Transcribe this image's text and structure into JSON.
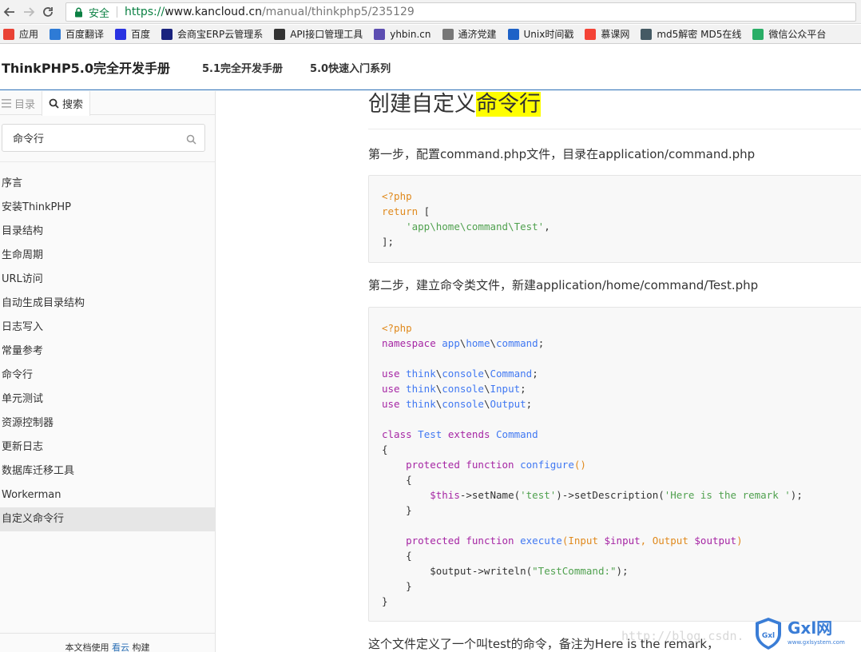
{
  "browser": {
    "secure_label": "安全",
    "url_protocol": "https://",
    "url_host": "www.kancloud.cn",
    "url_path": "/manual/thinkphp5/235129"
  },
  "bookmarks": [
    {
      "label": "应用",
      "icon": "apps-grid-icon",
      "color": "#e94235"
    },
    {
      "label": "百度翻译",
      "icon": "baidu-fanyi-icon",
      "color": "#2e7bd6"
    },
    {
      "label": "百度",
      "icon": "baidu-paw-icon",
      "color": "#2932e1"
    },
    {
      "label": "会商宝ERP云管理系",
      "icon": "bird-icon",
      "color": "#1a237e"
    },
    {
      "label": "API接口管理工具",
      "icon": "shuffle-icon",
      "color": "#333333"
    },
    {
      "label": "yhbin.cn",
      "icon": "shield-icon",
      "color": "#5c4db1"
    },
    {
      "label": "通济党建",
      "icon": "page-icon",
      "color": "#777777"
    },
    {
      "label": "Unix时间戳",
      "icon": "unix-icon",
      "color": "#1e62c7"
    },
    {
      "label": "慕课网",
      "icon": "fire-icon",
      "color": "#f44336"
    },
    {
      "label": "md5解密 MD5在线",
      "icon": "md5-icon",
      "color": "#455a64"
    },
    {
      "label": "微信公众平台",
      "icon": "wechat-icon",
      "color": "#2aae67"
    }
  ],
  "site": {
    "title": "ThinkPHP5.0完全开发手册",
    "nav": [
      "5.1完全开发手册",
      "5.0快速入门系列"
    ]
  },
  "sidebar": {
    "tabs": [
      {
        "label": "目录"
      },
      {
        "label": "搜索"
      }
    ],
    "search_value": "命令行",
    "items": [
      "序言",
      "安装ThinkPHP",
      "目录结构",
      "生命周期",
      "URL访问",
      "自动生成目录结构",
      "日志写入",
      "常量参考",
      "命令行",
      "单元测试",
      "资源控制器",
      "更新日志",
      "数据库迁移工具",
      "Workerman",
      "自定义命令行"
    ],
    "active_index": 14,
    "footer": {
      "prefix": "本文档使用 ",
      "link": "看云",
      "suffix": " 构建"
    }
  },
  "article": {
    "title_plain": "创建自定义",
    "title_highlight": "命令行",
    "step1": "第一步，配置command.php文件，目录在application/command.php",
    "step2": "第二步，建立命令类文件，新建application/home/command/Test.php",
    "step3": "这个文件定义了一个叫test的命令，备注为Here is the remark，"
  },
  "code1": [
    [
      [
        "op",
        "<?php"
      ]
    ],
    [
      [
        "op",
        "return"
      ],
      [
        "pl",
        " ["
      ]
    ],
    [
      [
        "pl",
        "    "
      ],
      [
        "st",
        "'app\\home\\command\\Test'"
      ],
      [
        "pl",
        ","
      ]
    ],
    [
      [
        "pl",
        "];"
      ]
    ]
  ],
  "code2": [
    [
      [
        "op",
        "<?php"
      ]
    ],
    [
      [
        "kw",
        "namespace"
      ],
      [
        "pl",
        " "
      ],
      [
        "ty",
        "app"
      ],
      [
        "pl",
        "\\"
      ],
      [
        "ty",
        "home"
      ],
      [
        "pl",
        "\\"
      ],
      [
        "ty",
        "command"
      ],
      [
        "pl",
        ";"
      ]
    ],
    [],
    [
      [
        "kw",
        "use"
      ],
      [
        "pl",
        " "
      ],
      [
        "ty",
        "think"
      ],
      [
        "pl",
        "\\"
      ],
      [
        "ty",
        "console"
      ],
      [
        "pl",
        "\\"
      ],
      [
        "ty",
        "Command"
      ],
      [
        "pl",
        ";"
      ]
    ],
    [
      [
        "kw",
        "use"
      ],
      [
        "pl",
        " "
      ],
      [
        "ty",
        "think"
      ],
      [
        "pl",
        "\\"
      ],
      [
        "ty",
        "console"
      ],
      [
        "pl",
        "\\"
      ],
      [
        "ty",
        "Input"
      ],
      [
        "pl",
        ";"
      ]
    ],
    [
      [
        "kw",
        "use"
      ],
      [
        "pl",
        " "
      ],
      [
        "ty",
        "think"
      ],
      [
        "pl",
        "\\"
      ],
      [
        "ty",
        "console"
      ],
      [
        "pl",
        "\\"
      ],
      [
        "ty",
        "Output"
      ],
      [
        "pl",
        ";"
      ]
    ],
    [],
    [
      [
        "kw",
        "class"
      ],
      [
        "pl",
        " "
      ],
      [
        "ty",
        "Test"
      ],
      [
        "pl",
        " "
      ],
      [
        "kw",
        "extends"
      ],
      [
        "pl",
        " "
      ],
      [
        "ty",
        "Command"
      ]
    ],
    [
      [
        "pl",
        "{"
      ]
    ],
    [
      [
        "pl",
        "    "
      ],
      [
        "kw",
        "protected"
      ],
      [
        "pl",
        " "
      ],
      [
        "kw",
        "function"
      ],
      [
        "pl",
        " "
      ],
      [
        "ty",
        "configure"
      ],
      [
        "op",
        "()"
      ]
    ],
    [
      [
        "pl",
        "    {"
      ]
    ],
    [
      [
        "pl",
        "        "
      ],
      [
        "va",
        "$this"
      ],
      [
        "pl",
        "->setName("
      ],
      [
        "st",
        "'test'"
      ],
      [
        "pl",
        ")->setDescription("
      ],
      [
        "st",
        "'Here is the remark '"
      ],
      [
        "pl",
        ");"
      ]
    ],
    [
      [
        "pl",
        "    }"
      ]
    ],
    [],
    [
      [
        "pl",
        "    "
      ],
      [
        "kw",
        "protected"
      ],
      [
        "pl",
        " "
      ],
      [
        "kw",
        "function"
      ],
      [
        "pl",
        " "
      ],
      [
        "ty",
        "execute"
      ],
      [
        "op",
        "(Input "
      ],
      [
        "va",
        "$input"
      ],
      [
        "op",
        ", Output "
      ],
      [
        "va",
        "$output"
      ],
      [
        "op",
        ")"
      ]
    ],
    [
      [
        "pl",
        "    {"
      ]
    ],
    [
      [
        "pl",
        "        $output->writeln("
      ],
      [
        "st",
        "\"TestCommand:\""
      ],
      [
        "pl",
        ");"
      ]
    ],
    [
      [
        "pl",
        "    }"
      ]
    ],
    [
      [
        "pl",
        "}"
      ]
    ]
  ],
  "watermark": "http://blog.csdn.",
  "logo": {
    "badge": "Gxl",
    "text": "Gxl网",
    "site": "www.gxlsystem.com"
  }
}
